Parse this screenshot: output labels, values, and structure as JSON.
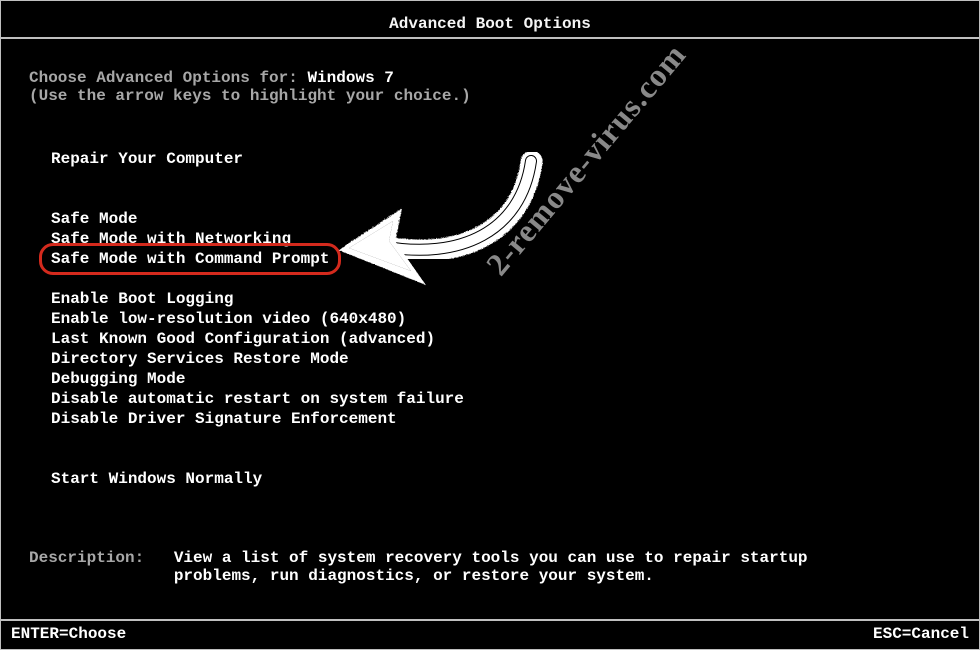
{
  "title": "Advanced Boot Options",
  "prompt_prefix": "Choose Advanced Options for: ",
  "os_name": "Windows 7",
  "hint": "(Use the arrow keys to highlight your choice.)",
  "options": [
    "Repair Your Computer",
    "",
    "",
    "Safe Mode",
    "Safe Mode with Networking",
    "Safe Mode with Command Prompt",
    "",
    "Enable Boot Logging",
    "Enable low-resolution video (640x480)",
    "Last Known Good Configuration (advanced)",
    "Directory Services Restore Mode",
    "Debugging Mode",
    "Disable automatic restart on system failure",
    "Disable Driver Signature Enforcement",
    "",
    "",
    "Start Windows Normally"
  ],
  "highlight_index": 5,
  "description_label": "Description:",
  "description_text": "View a list of system recovery tools you can use to repair startup problems, run diagnostics, or restore your system.",
  "footer_left": "ENTER=Choose",
  "footer_right": "ESC=Cancel",
  "watermark": "2-remove-virus.com"
}
